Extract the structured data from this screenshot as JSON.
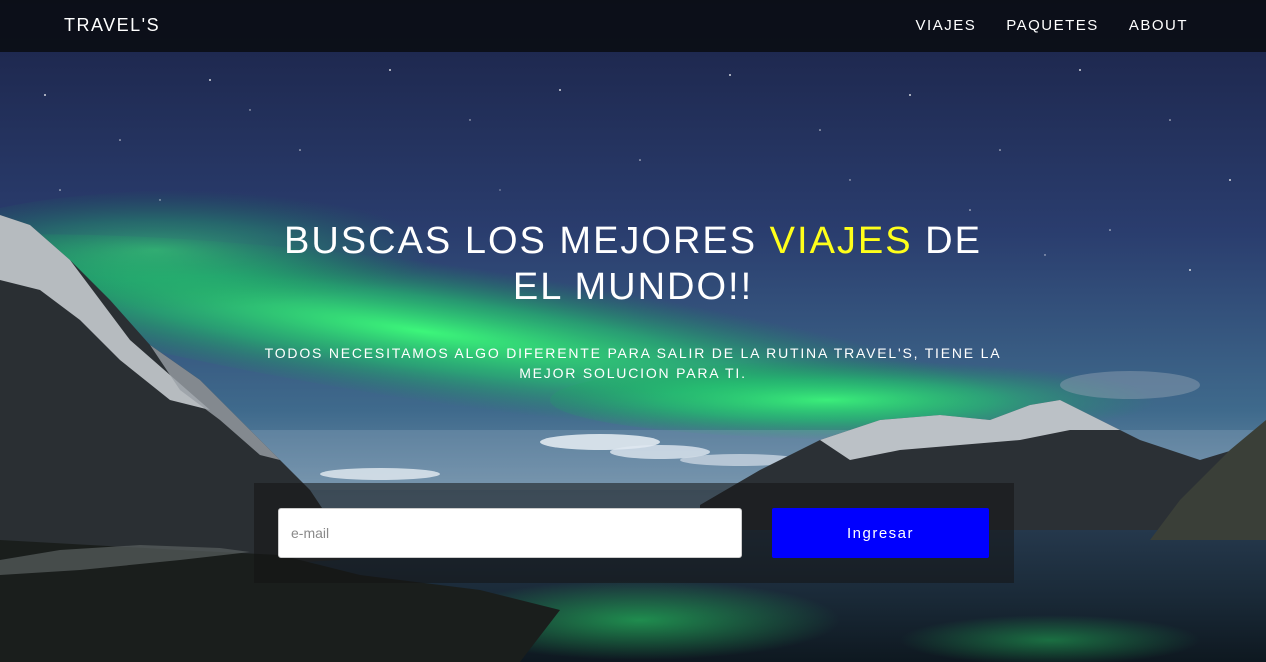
{
  "navbar": {
    "brand": "TRAVEL'S",
    "links": [
      "VIAJES",
      "PAQUETES",
      "ABOUT"
    ]
  },
  "hero": {
    "title_part1": "BUSCAS LOS MEJORES ",
    "title_highlight": "VIAJES",
    "title_part2": " DE",
    "title_line2": "EL MUNDO!!",
    "subtitle_line1": "TODOS NECESITAMOS ALGO DIFERENTE PARA SALIR DE LA RUTINA TRAVEL'S, TIENE LA",
    "subtitle_line2": "MEJOR SOLUCION PARA TI."
  },
  "form": {
    "email_placeholder": "e-mail",
    "email_value": "",
    "submit_label": "Ingresar"
  },
  "colors": {
    "highlight": "#ffff1a",
    "button": "#0000ff",
    "navbar": "#0a0c12"
  }
}
